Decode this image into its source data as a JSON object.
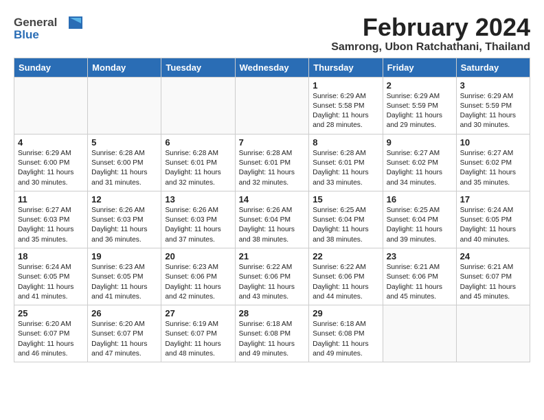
{
  "header": {
    "logo_general": "General",
    "logo_blue": "Blue",
    "month_year": "February 2024",
    "location": "Samrong, Ubon Ratchathani, Thailand"
  },
  "weekdays": [
    "Sunday",
    "Monday",
    "Tuesday",
    "Wednesday",
    "Thursday",
    "Friday",
    "Saturday"
  ],
  "weeks": [
    [
      {
        "day": "",
        "info": ""
      },
      {
        "day": "",
        "info": ""
      },
      {
        "day": "",
        "info": ""
      },
      {
        "day": "",
        "info": ""
      },
      {
        "day": "1",
        "info": "Sunrise: 6:29 AM\nSunset: 5:58 PM\nDaylight: 11 hours and 28 minutes."
      },
      {
        "day": "2",
        "info": "Sunrise: 6:29 AM\nSunset: 5:59 PM\nDaylight: 11 hours and 29 minutes."
      },
      {
        "day": "3",
        "info": "Sunrise: 6:29 AM\nSunset: 5:59 PM\nDaylight: 11 hours and 30 minutes."
      }
    ],
    [
      {
        "day": "4",
        "info": "Sunrise: 6:29 AM\nSunset: 6:00 PM\nDaylight: 11 hours and 30 minutes."
      },
      {
        "day": "5",
        "info": "Sunrise: 6:28 AM\nSunset: 6:00 PM\nDaylight: 11 hours and 31 minutes."
      },
      {
        "day": "6",
        "info": "Sunrise: 6:28 AM\nSunset: 6:01 PM\nDaylight: 11 hours and 32 minutes."
      },
      {
        "day": "7",
        "info": "Sunrise: 6:28 AM\nSunset: 6:01 PM\nDaylight: 11 hours and 32 minutes."
      },
      {
        "day": "8",
        "info": "Sunrise: 6:28 AM\nSunset: 6:01 PM\nDaylight: 11 hours and 33 minutes."
      },
      {
        "day": "9",
        "info": "Sunrise: 6:27 AM\nSunset: 6:02 PM\nDaylight: 11 hours and 34 minutes."
      },
      {
        "day": "10",
        "info": "Sunrise: 6:27 AM\nSunset: 6:02 PM\nDaylight: 11 hours and 35 minutes."
      }
    ],
    [
      {
        "day": "11",
        "info": "Sunrise: 6:27 AM\nSunset: 6:03 PM\nDaylight: 11 hours and 35 minutes."
      },
      {
        "day": "12",
        "info": "Sunrise: 6:26 AM\nSunset: 6:03 PM\nDaylight: 11 hours and 36 minutes."
      },
      {
        "day": "13",
        "info": "Sunrise: 6:26 AM\nSunset: 6:03 PM\nDaylight: 11 hours and 37 minutes."
      },
      {
        "day": "14",
        "info": "Sunrise: 6:26 AM\nSunset: 6:04 PM\nDaylight: 11 hours and 38 minutes."
      },
      {
        "day": "15",
        "info": "Sunrise: 6:25 AM\nSunset: 6:04 PM\nDaylight: 11 hours and 38 minutes."
      },
      {
        "day": "16",
        "info": "Sunrise: 6:25 AM\nSunset: 6:04 PM\nDaylight: 11 hours and 39 minutes."
      },
      {
        "day": "17",
        "info": "Sunrise: 6:24 AM\nSunset: 6:05 PM\nDaylight: 11 hours and 40 minutes."
      }
    ],
    [
      {
        "day": "18",
        "info": "Sunrise: 6:24 AM\nSunset: 6:05 PM\nDaylight: 11 hours and 41 minutes."
      },
      {
        "day": "19",
        "info": "Sunrise: 6:23 AM\nSunset: 6:05 PM\nDaylight: 11 hours and 41 minutes."
      },
      {
        "day": "20",
        "info": "Sunrise: 6:23 AM\nSunset: 6:06 PM\nDaylight: 11 hours and 42 minutes."
      },
      {
        "day": "21",
        "info": "Sunrise: 6:22 AM\nSunset: 6:06 PM\nDaylight: 11 hours and 43 minutes."
      },
      {
        "day": "22",
        "info": "Sunrise: 6:22 AM\nSunset: 6:06 PM\nDaylight: 11 hours and 44 minutes."
      },
      {
        "day": "23",
        "info": "Sunrise: 6:21 AM\nSunset: 6:06 PM\nDaylight: 11 hours and 45 minutes."
      },
      {
        "day": "24",
        "info": "Sunrise: 6:21 AM\nSunset: 6:07 PM\nDaylight: 11 hours and 45 minutes."
      }
    ],
    [
      {
        "day": "25",
        "info": "Sunrise: 6:20 AM\nSunset: 6:07 PM\nDaylight: 11 hours and 46 minutes."
      },
      {
        "day": "26",
        "info": "Sunrise: 6:20 AM\nSunset: 6:07 PM\nDaylight: 11 hours and 47 minutes."
      },
      {
        "day": "27",
        "info": "Sunrise: 6:19 AM\nSunset: 6:07 PM\nDaylight: 11 hours and 48 minutes."
      },
      {
        "day": "28",
        "info": "Sunrise: 6:18 AM\nSunset: 6:08 PM\nDaylight: 11 hours and 49 minutes."
      },
      {
        "day": "29",
        "info": "Sunrise: 6:18 AM\nSunset: 6:08 PM\nDaylight: 11 hours and 49 minutes."
      },
      {
        "day": "",
        "info": ""
      },
      {
        "day": "",
        "info": ""
      }
    ]
  ]
}
